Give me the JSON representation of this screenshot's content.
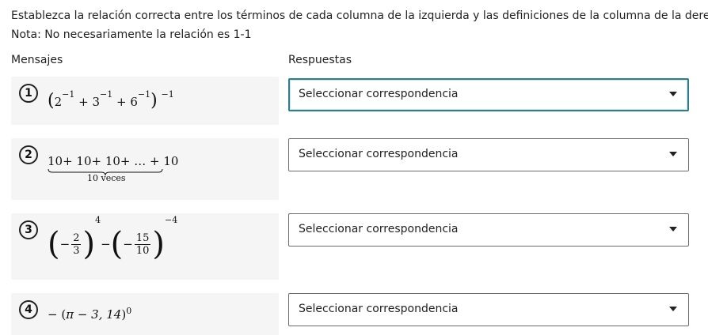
{
  "instructions": {
    "line1": "Establezca la relación correcta entre los términos de cada columna de la izquierda y las definiciones de la columna de la derecha.",
    "line2": "Nota: No necesariamente la relación es 1-1"
  },
  "headers": {
    "left": "Mensajes",
    "right": "Respuestas"
  },
  "items": [
    {
      "number": "1",
      "expr": {
        "open": "(",
        "t1": "2",
        "t1_exp": "−1",
        "plus1": "+ 3",
        "t2_exp": "−1",
        "plus2": "+ 6",
        "t3_exp": "−1",
        "close": ")",
        "outer_exp": "−1"
      },
      "select": "Seleccionar correspondencia"
    },
    {
      "number": "2",
      "expr": {
        "top": "10+ 10+ 10+ … + 10",
        "under": "10 veces"
      },
      "select": "Seleccionar correspondencia"
    },
    {
      "number": "3",
      "expr": {
        "minus1": "−",
        "f1_num": "2",
        "f1_den": "3",
        "exp1": "4",
        "mid": "−",
        "minus2": "−",
        "f2_num": "15",
        "f2_den": "10",
        "exp2": "−4"
      },
      "select": "Seleccionar correspondencia"
    },
    {
      "number": "4",
      "expr": {
        "lead": "− (",
        "body": "π − 3, 14",
        "close": ")",
        "exp": "0"
      },
      "select": "Seleccionar correspondencia"
    }
  ]
}
